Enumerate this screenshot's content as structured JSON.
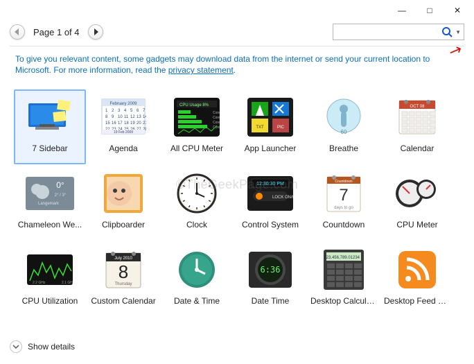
{
  "titlebar": {
    "minimize": "—",
    "maximize": "□",
    "close": "✕"
  },
  "pager": {
    "label": "Page 1 of 4"
  },
  "search": {
    "placeholder": ""
  },
  "notice": {
    "text_prefix": "To give you relevant content, some gadgets may download data from the internet or send your current location to Microsoft. For more information, read the ",
    "link": "privacy statement",
    "text_suffix": "."
  },
  "gadgets": [
    {
      "label": "7 Sidebar",
      "icon": "seven-sidebar-icon",
      "selected": true
    },
    {
      "label": "Agenda",
      "icon": "agenda-icon"
    },
    {
      "label": "All CPU Meter",
      "icon": "all-cpu-meter-icon"
    },
    {
      "label": "App Launcher",
      "icon": "app-launcher-icon"
    },
    {
      "label": "Breathe",
      "icon": "breathe-icon"
    },
    {
      "label": "Calendar",
      "icon": "calendar-icon"
    },
    {
      "label": "Chameleon We...",
      "icon": "chameleon-weather-icon"
    },
    {
      "label": "Clipboarder",
      "icon": "clipboarder-icon"
    },
    {
      "label": "Clock",
      "icon": "clock-icon"
    },
    {
      "label": "Control System",
      "icon": "control-system-icon"
    },
    {
      "label": "Countdown",
      "icon": "countdown-icon"
    },
    {
      "label": "CPU Meter",
      "icon": "cpu-meter-icon"
    },
    {
      "label": "CPU Utilization",
      "icon": "cpu-utilization-icon"
    },
    {
      "label": "Custom Calendar",
      "icon": "custom-calendar-icon"
    },
    {
      "label": "Date & Time",
      "icon": "date-time-round-icon"
    },
    {
      "label": "Date Time",
      "icon": "date-time-digital-icon"
    },
    {
      "label": "Desktop Calcula...",
      "icon": "desktop-calculator-icon"
    },
    {
      "label": "Desktop Feed R...",
      "icon": "desktop-feed-icon"
    }
  ],
  "details": {
    "label": "Show details"
  },
  "watermark": "©TheGeekPage.com"
}
